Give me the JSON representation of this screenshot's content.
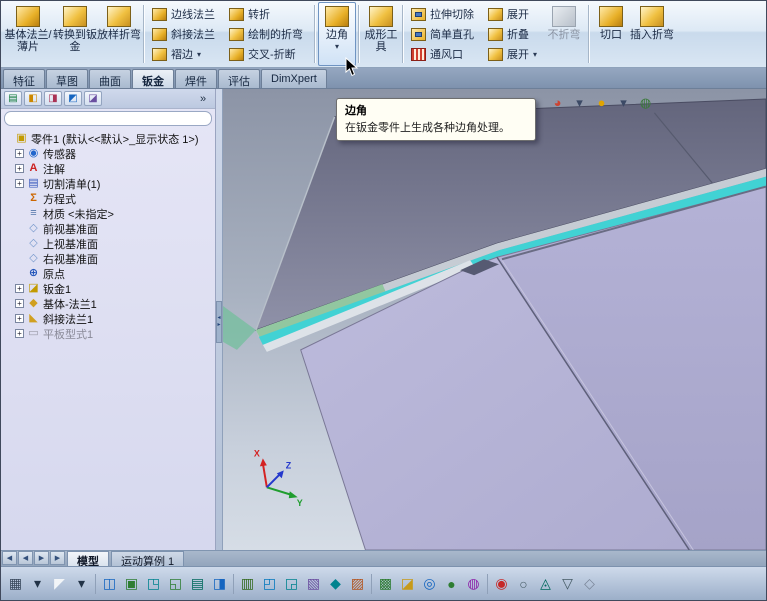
{
  "ribbon": {
    "large_buttons": [
      {
        "label": "基体法兰/薄片"
      },
      {
        "label": "转换到钣金"
      },
      {
        "label": "放样折弯"
      }
    ],
    "col_a": [
      {
        "label": "边线法兰",
        "ic": "ic-gold"
      },
      {
        "label": "斜接法兰",
        "ic": "ic-gold"
      },
      {
        "label": "褶边",
        "ic": "ic-gold2",
        "extra": "▾"
      }
    ],
    "col_b": [
      {
        "label": "转折",
        "ic": "ic-gold"
      },
      {
        "label": "绘制的折弯",
        "ic": "ic-gold2"
      },
      {
        "label": "交叉-折断",
        "ic": "ic-gold"
      }
    ],
    "corner_button": {
      "label": "边角",
      "dropdown": "▾"
    },
    "forming_tool": {
      "label": "成形工具"
    },
    "col_c": [
      {
        "label": "拉伸切除",
        "ic": "ic-cut"
      },
      {
        "label": "简单直孔",
        "ic": "ic-cut"
      },
      {
        "label": "通风口",
        "ic": "ic-vent"
      }
    ],
    "col_d": [
      {
        "label": "展开",
        "ic": "ic-gold2"
      },
      {
        "label": "折叠",
        "ic": "ic-gold2"
      },
      {
        "label": "展开",
        "ic": "ic-gold2",
        "extra": "▾"
      }
    ],
    "no_bends": {
      "label": "不折弯"
    },
    "rip": {
      "label": "切口"
    },
    "insert_bends": {
      "label": "插入折弯"
    }
  },
  "command_tabs": [
    {
      "label": "特征",
      "cls": ""
    },
    {
      "label": "草图",
      "cls": ""
    },
    {
      "label": "曲面",
      "cls": ""
    },
    {
      "label": "钣金",
      "cls": "active"
    },
    {
      "label": "焊件",
      "cls": ""
    },
    {
      "label": "评估",
      "cls": ""
    },
    {
      "label": "DimXpert",
      "cls": ""
    }
  ],
  "panel_tabs": [
    {
      "g": "▤",
      "c": "#0f7a3a"
    },
    {
      "g": "◧",
      "c": "#cc8800"
    },
    {
      "g": "◨",
      "c": "#aa3355"
    },
    {
      "g": "◩",
      "c": "#1565c0"
    },
    {
      "g": "◪",
      "c": "#6a4fa0"
    },
    {
      "g": "»",
      "c": "#223347"
    }
  ],
  "tooltip": {
    "title": "边角",
    "body": "在钣金零件上生成各种边角处理。"
  },
  "feature_tree": {
    "root": "零件1  (默认<<默认>_显示状态 1>)",
    "root_glyph": "▣",
    "root_color": "#c29a00",
    "items": [
      {
        "label": "传感器",
        "glyph": "◉",
        "c": "#2266cc",
        "expandCls": "has",
        "mutedCls": ""
      },
      {
        "label": "注解",
        "glyph": "A",
        "c": "#cc2222",
        "expandCls": "has",
        "mutedCls": ""
      },
      {
        "label": "切割清单(1)",
        "glyph": "▤",
        "c": "#3355bb",
        "expandCls": "has",
        "mutedCls": ""
      },
      {
        "label": "方程式",
        "glyph": "Σ",
        "c": "#cc6600",
        "expandCls": "",
        "mutedCls": ""
      },
      {
        "label": "材质 <未指定>",
        "glyph": "≡",
        "c": "#5577aa",
        "expandCls": "",
        "mutedCls": ""
      },
      {
        "label": "前视基准面",
        "glyph": "◇",
        "c": "#7799cc",
        "expandCls": "",
        "mutedCls": ""
      },
      {
        "label": "上视基准面",
        "glyph": "◇",
        "c": "#7799cc",
        "expandCls": "",
        "mutedCls": ""
      },
      {
        "label": "右视基准面",
        "glyph": "◇",
        "c": "#7799cc",
        "expandCls": "",
        "mutedCls": ""
      },
      {
        "label": "原点",
        "glyph": "⊕",
        "c": "#2255bb",
        "expandCls": "",
        "mutedCls": ""
      },
      {
        "label": "钣金1",
        "glyph": "◪",
        "c": "#c29a00",
        "expandCls": "has",
        "mutedCls": ""
      },
      {
        "label": "基体-法兰1",
        "glyph": "◆",
        "c": "#d0a020",
        "expandCls": "has",
        "mutedCls": ""
      },
      {
        "label": "斜接法兰1",
        "glyph": "◣",
        "c": "#d0a020",
        "expandCls": "has",
        "mutedCls": ""
      },
      {
        "label": "平板型式1",
        "glyph": "▭",
        "c": "#9a9aa8",
        "expandCls": "has",
        "mutedCls": "muted"
      }
    ]
  },
  "hud_icons": [
    {
      "g": "▭",
      "c": "#3c4a66"
    },
    {
      "g": "⊞",
      "c": "#3c4a66"
    },
    {
      "g": "◔",
      "c": "#3c4a66"
    },
    {
      "g": "↻",
      "c": "#3c4a66"
    },
    {
      "g": "▦",
      "c": "#3c4a66"
    },
    {
      "g": "◧",
      "c": "#3c4a66"
    },
    {
      "g": "▾",
      "c": "#3c4a66"
    },
    {
      "g": "◐",
      "c": "#3c4a66"
    },
    {
      "g": "◕",
      "c": "#cc4433"
    },
    {
      "g": "▾",
      "c": "#3c4a66"
    },
    {
      "g": "●",
      "c": "#e0a400"
    },
    {
      "g": "▾",
      "c": "#3c4a66"
    },
    {
      "g": "◍",
      "c": "#3a7a3a"
    }
  ],
  "bottom_tabs": [
    {
      "label": "模型",
      "cls": "active"
    },
    {
      "label": "运动算例 1",
      "cls": ""
    }
  ],
  "nav_buttons": [
    {
      "g": "◀"
    },
    {
      "g": "◀"
    },
    {
      "g": "▶"
    },
    {
      "g": "▶"
    }
  ],
  "status_icons": [
    {
      "g": "▦",
      "c": "#37475a",
      "cls": ""
    },
    {
      "g": "▾",
      "c": "#223347",
      "cls": ""
    },
    {
      "g": "◤",
      "c": "#f2f5f8",
      "cls": ""
    },
    {
      "g": "▾",
      "c": "#223347",
      "cls": ""
    },
    {
      "g": "",
      "c": "",
      "cls": "st-sep"
    },
    {
      "g": "◫",
      "c": "#1565c0",
      "cls": ""
    },
    {
      "g": "▣",
      "c": "#2e7d32",
      "cls": ""
    },
    {
      "g": "◳",
      "c": "#00838f",
      "cls": ""
    },
    {
      "g": "◱",
      "c": "#2e7d32",
      "cls": ""
    },
    {
      "g": "▤",
      "c": "#00695c",
      "cls": ""
    },
    {
      "g": "◨",
      "c": "#1565c0",
      "cls": ""
    },
    {
      "g": "",
      "c": "",
      "cls": "st-sep"
    },
    {
      "g": "▥",
      "c": "#33691e",
      "cls": ""
    },
    {
      "g": "◰",
      "c": "#0277bd",
      "cls": ""
    },
    {
      "g": "◲",
      "c": "#00838f",
      "cls": ""
    },
    {
      "g": "▧",
      "c": "#6a4fa0",
      "cls": ""
    },
    {
      "g": "◆",
      "c": "#00838f",
      "cls": ""
    },
    {
      "g": "▨",
      "c": "#b3541e",
      "cls": ""
    },
    {
      "g": "",
      "c": "",
      "cls": "st-sep"
    },
    {
      "g": "▩",
      "c": "#2e7d32",
      "cls": ""
    },
    {
      "g": "◪",
      "c": "#c79a1a",
      "cls": ""
    },
    {
      "g": "◎",
      "c": "#1565c0",
      "cls": ""
    },
    {
      "g": "●",
      "c": "#2e7d32",
      "cls": ""
    },
    {
      "g": "◍",
      "c": "#8e24aa",
      "cls": ""
    },
    {
      "g": "",
      "c": "",
      "cls": "st-sep"
    },
    {
      "g": "◉",
      "c": "#c62828",
      "cls": ""
    },
    {
      "g": "○",
      "c": "#455a64",
      "cls": ""
    },
    {
      "g": "◬",
      "c": "#00695c",
      "cls": ""
    },
    {
      "g": "▽",
      "c": "#455a64",
      "cls": ""
    },
    {
      "g": "◇",
      "c": "#7a8699",
      "cls": ""
    }
  ],
  "triad": {
    "x": "X",
    "y": "Y",
    "z": "Z"
  },
  "colors": {
    "part_main": "#b6b4d8",
    "part_right": "#adabd0",
    "part_top_dark": "#6f7188",
    "edge_highlight_cyan": "#41d2d4",
    "edge_green": "#8cc79a",
    "triad_x": "#d42222",
    "triad_y": "#1f9d2e",
    "triad_z": "#2438cc"
  }
}
